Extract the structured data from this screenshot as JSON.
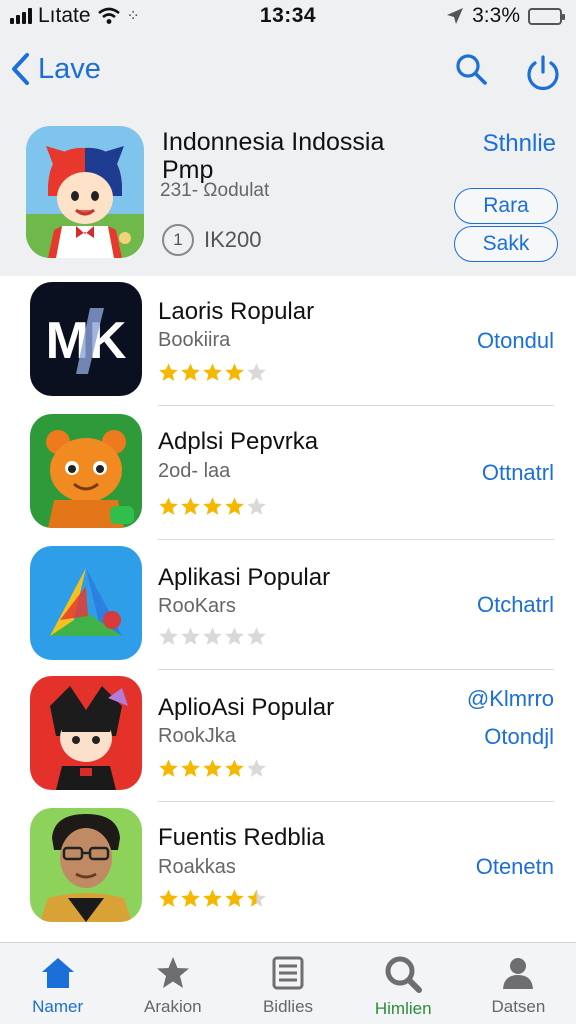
{
  "status_bar": {
    "carrier": "Lıtate",
    "time": "13:34",
    "battery_percent": "3:3%"
  },
  "nav": {
    "back_label": "Lave",
    "icons": [
      "search-icon",
      "power-icon"
    ],
    "accent_color": "#1b6fd8"
  },
  "featured": {
    "title": "Indonnesia Indossia Pmp",
    "subtitle": "231- Ωodulat",
    "number": "1",
    "count": "IK200",
    "link": "Sthnlie",
    "button_primary": "Rara",
    "button_secondary": "Sakk"
  },
  "apps": [
    {
      "name": "Laoris Ropular",
      "subtitle": "Bookiira",
      "action": "Otondul",
      "extra": "",
      "rating": 4
    },
    {
      "name": "Adplsi Pepvrka",
      "subtitle": "2od- laa",
      "action": "Ottnatrl",
      "extra": "",
      "rating": 4
    },
    {
      "name": "Aplikasi Popular",
      "subtitle": "RooKars",
      "action": "Otchatrl",
      "extra": "",
      "rating": 0
    },
    {
      "name": "AplioAsi Popular",
      "subtitle": "RookJka",
      "action": "Otondjl",
      "extra": "@Klmrro",
      "rating": 4
    },
    {
      "name": "Fuentis Redblia",
      "subtitle": "Roakkas",
      "action": "Otenetn",
      "extra": "",
      "rating": 4.5
    }
  ],
  "tabs": [
    {
      "label": "Namer",
      "icon": "home-icon",
      "active": true
    },
    {
      "label": "Arakion",
      "icon": "star-icon",
      "active": false
    },
    {
      "label": "Bidlies",
      "icon": "list-icon",
      "active": false
    },
    {
      "label": "Himlien",
      "icon": "search-icon",
      "active": false
    },
    {
      "label": "Datsen",
      "icon": "person-icon",
      "active": false
    }
  ],
  "colors": {
    "accent": "#1b6fd8",
    "star": "#f5b800",
    "star_empty": "#d9d9d9",
    "tab_active": "#1b6fd8",
    "tab_search_label": "#2e8b3a"
  }
}
